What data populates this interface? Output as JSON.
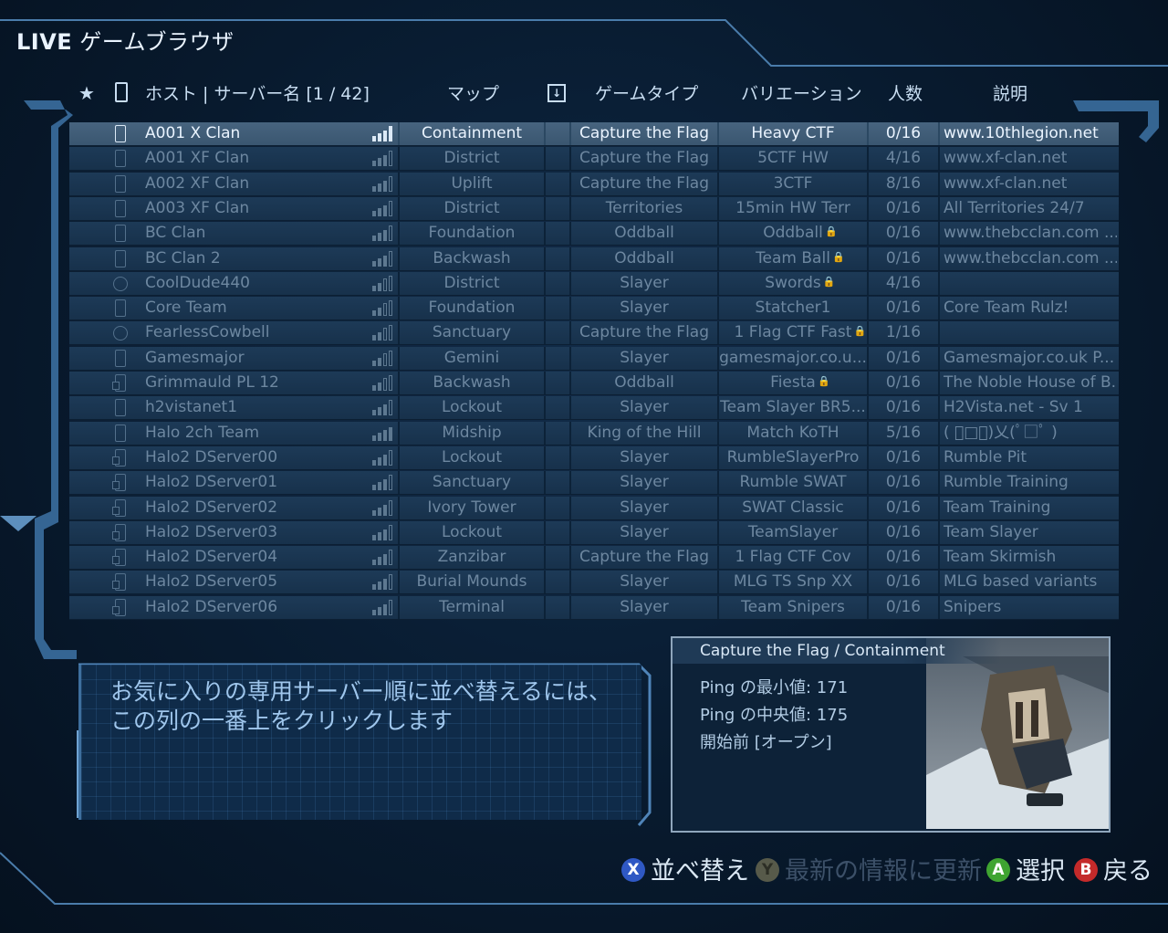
{
  "window": {
    "title_brand": "LIVE",
    "title_text": "ゲームブラウザ"
  },
  "columns": {
    "favorite": "★",
    "host": "ホスト | サーバー名 [1 / 42]",
    "map": "マップ",
    "game_type": "ゲームタイプ",
    "variation": "バリエーション",
    "players": "人数",
    "description": "説明"
  },
  "rows": [
    {
      "name": "A001 X Clan",
      "map": "Containment",
      "gametype": "Capture the Flag",
      "variant": "Heavy CTF",
      "players": "0/16",
      "desc": "www.10thlegion.net",
      "selected": true,
      "icon": "device-icon",
      "signal": 3
    },
    {
      "name": "A001 XF Clan",
      "map": "District",
      "gametype": "Capture the Flag",
      "variant": "5CTF HW",
      "players": "4/16",
      "desc": "www.xf-clan.net",
      "icon": "device-icon",
      "signal": 3
    },
    {
      "name": "A002 XF Clan",
      "map": "Uplift",
      "gametype": "Capture the Flag",
      "variant": "3CTF",
      "players": "8/16",
      "desc": "www.xf-clan.net",
      "icon": "device-icon",
      "signal": 3
    },
    {
      "name": "A003 XF Clan",
      "map": "District",
      "gametype": "Territories",
      "variant": "15min HW Terr",
      "players": "0/16",
      "desc": "All Territories 24/7",
      "icon": "device-icon",
      "signal": 3
    },
    {
      "name": "BC Clan",
      "map": "Foundation",
      "gametype": "Oddball",
      "variant": "Oddball",
      "locked": true,
      "players": "0/16",
      "desc": "www.thebcclan.com ...",
      "icon": "device-icon",
      "signal": 3
    },
    {
      "name": "BC Clan 2",
      "map": "Backwash",
      "gametype": "Oddball",
      "variant": "Team Ball",
      "locked": true,
      "players": "0/16",
      "desc": "www.thebcclan.com ...",
      "icon": "device-icon",
      "signal": 3
    },
    {
      "name": "CoolDude440",
      "map": "District",
      "gametype": "Slayer",
      "variant": "Swords",
      "locked": true,
      "players": "4/16",
      "desc": "",
      "icon": "lock-circle-icon",
      "signal": 2
    },
    {
      "name": "Core Team",
      "map": "Foundation",
      "gametype": "Slayer",
      "variant": "Statcher1",
      "players": "0/16",
      "desc": "Core Team Rulz!",
      "icon": "device-icon",
      "signal": 2
    },
    {
      "name": "FearlessCowbell",
      "map": "Sanctuary",
      "gametype": "Capture the Flag",
      "variant": "1 Flag CTF Fast",
      "locked": true,
      "players": "1/16",
      "desc": "",
      "icon": "lock-circle-icon",
      "signal": 2
    },
    {
      "name": "Gamesmajor",
      "map": "Gemini",
      "gametype": "Slayer",
      "variant": "gamesmajor.co.u...",
      "players": "0/16",
      "desc": "Gamesmajor.co.uk P...",
      "icon": "device-icon",
      "signal": 2
    },
    {
      "name": "Grimmauld PL 12",
      "map": "Backwash",
      "gametype": "Oddball",
      "variant": "Fiesta",
      "locked": true,
      "players": "0/16",
      "desc": "The Noble House of B...",
      "icon": "device-box-icon",
      "signal": 2
    },
    {
      "name": "h2vistanet1",
      "map": "Lockout",
      "gametype": "Slayer",
      "variant": "Team Slayer BR5...",
      "players": "0/16",
      "desc": "H2Vista.net - Sv 1",
      "icon": "device-icon",
      "signal": 3
    },
    {
      "name": "Halo 2ch Team",
      "map": "Midship",
      "gametype": "King of the Hill",
      "variant": "Match KoTH",
      "players": "5/16",
      "desc": "( ﾟ□ﾟ)乂(ﾟ□ﾟ )",
      "icon": "device-icon",
      "signal": 4
    },
    {
      "name": "Halo2 DServer00",
      "map": "Lockout",
      "gametype": "Slayer",
      "variant": "RumbleSlayerPro",
      "players": "0/16",
      "desc": "Rumble Pit",
      "icon": "device-box-icon",
      "signal": 3
    },
    {
      "name": "Halo2 DServer01",
      "map": "Sanctuary",
      "gametype": "Slayer",
      "variant": "Rumble SWAT",
      "players": "0/16",
      "desc": "Rumble Training",
      "icon": "device-box-icon",
      "signal": 3
    },
    {
      "name": "Halo2 DServer02",
      "map": "Ivory Tower",
      "gametype": "Slayer",
      "variant": "SWAT Classic",
      "players": "0/16",
      "desc": "Team Training",
      "icon": "device-box-icon",
      "signal": 3
    },
    {
      "name": "Halo2 DServer03",
      "map": "Lockout",
      "gametype": "Slayer",
      "variant": "TeamSlayer",
      "players": "0/16",
      "desc": "Team Slayer",
      "icon": "device-box-icon",
      "signal": 3
    },
    {
      "name": "Halo2 DServer04",
      "map": "Zanzibar",
      "gametype": "Capture the Flag",
      "variant": "1 Flag CTF Cov",
      "players": "0/16",
      "desc": "Team Skirmish",
      "icon": "device-box-icon",
      "signal": 3
    },
    {
      "name": "Halo2 DServer05",
      "map": "Burial Mounds",
      "gametype": "Slayer",
      "variant": "MLG TS Snp XX",
      "players": "0/16",
      "desc": "MLG based variants",
      "icon": "device-box-icon",
      "signal": 3
    },
    {
      "name": "Halo2 DServer06",
      "map": "Terminal",
      "gametype": "Slayer",
      "variant": "Team Snipers",
      "players": "0/16",
      "desc": "Snipers",
      "icon": "device-box-icon",
      "signal": 3
    }
  ],
  "help": {
    "text": "お気に入りの専用サーバー順に並べ替えるには、この列の一番上をクリックします"
  },
  "info": {
    "title": "Capture the Flag / Containment",
    "ping_min": "Ping の最小値: 171",
    "ping_median": "Ping の中央値: 175",
    "status": "開始前 [オープン]"
  },
  "legend": {
    "x_key": "X",
    "x_label": "並べ替え",
    "y_key": "Y",
    "y_label": "最新の情報に更新",
    "a_key": "A",
    "a_label": "選択",
    "b_key": "B",
    "b_label": "戻る"
  },
  "colors": {
    "background": "#081a2e",
    "frame": "#3e6f9e",
    "row": "#1d3a57",
    "row_selected": "#47647f"
  }
}
